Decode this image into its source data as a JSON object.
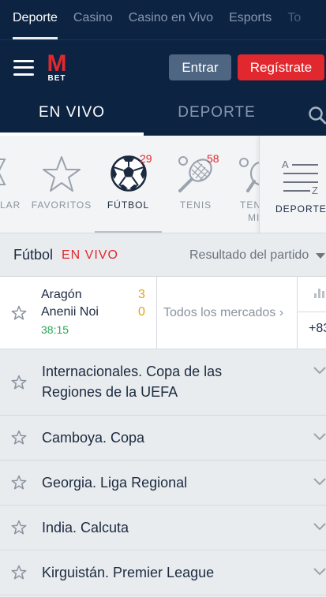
{
  "top_nav": {
    "tabs": [
      {
        "label": "Deporte"
      },
      {
        "label": "Casino"
      },
      {
        "label": "Casino en Vivo"
      },
      {
        "label": "Esports"
      },
      {
        "label": "To"
      }
    ]
  },
  "header": {
    "logo_letter": "M",
    "logo_sub": "BET",
    "login_label": "Entrar",
    "register_label": "Regístrate"
  },
  "mode_tabs": {
    "live": "EN VIVO",
    "sport": "DEPORTE"
  },
  "sports": [
    {
      "label": "LAR",
      "icon": "star-badge-icon"
    },
    {
      "label": "FAVORITOS",
      "icon": "star-outline-icon"
    },
    {
      "label": "FÚTBOL",
      "icon": "soccer-ball-icon",
      "count": "29"
    },
    {
      "label": "TENIS",
      "icon": "tennis-racket-icon",
      "count": "58"
    },
    {
      "label": "TEN",
      "label2": "MI",
      "icon": "table-tennis-icon"
    }
  ],
  "deportes_label": "DEPORTES",
  "deportes_icon_letters": {
    "top": "A",
    "bottom": "Z"
  },
  "section": {
    "sport": "Fútbol",
    "live": "EN VIVO",
    "market": "Resultado del partido"
  },
  "match": {
    "team1": "Aragón",
    "team2": "Anenii Noi",
    "score1": "3",
    "score2": "0",
    "time": "38:15",
    "markets_label": "Todos los mercados",
    "odd": "+83"
  },
  "leagues": [
    {
      "line1": "Internacionales. Copa de las",
      "line2": "Regiones de la UEFA"
    },
    {
      "line1": "Camboya. Copa"
    },
    {
      "line1": "Georgia. Liga Regional"
    },
    {
      "line1": "India. Calcuta"
    },
    {
      "line1": "Kirguistán. Premier League"
    }
  ],
  "colors": {
    "navy": "#0c2442",
    "brand_red": "#e0282e",
    "score": "#e6a11a",
    "time": "#2aa657"
  }
}
